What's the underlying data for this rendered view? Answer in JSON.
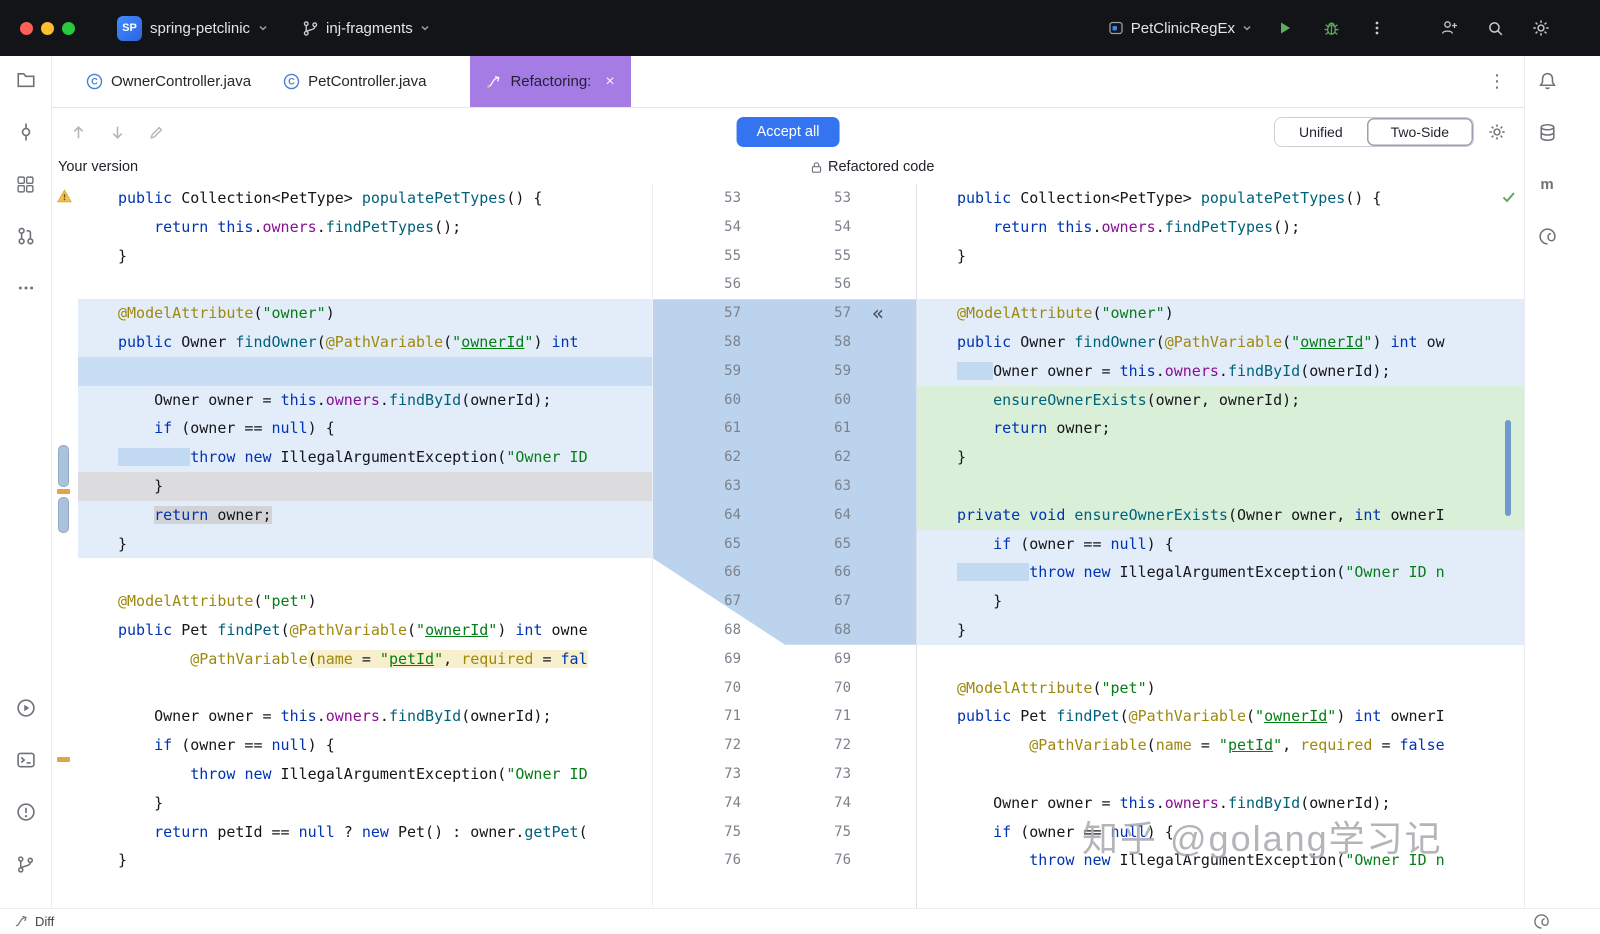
{
  "titlebar": {
    "project_badge": "SP",
    "project": "spring-petclinic",
    "branch": "inj-fragments",
    "run_config": "PetClinicRegEx"
  },
  "tabbar": {
    "tabs": [
      {
        "label": "OwnerController.java"
      },
      {
        "label": "PetController.java"
      },
      {
        "label": "Refactoring:",
        "active": true,
        "close": "×"
      }
    ]
  },
  "toolbar": {
    "accept_all": "Accept all",
    "view_modes": {
      "unified": "Unified",
      "two_side": "Two-Side",
      "selected": "Two-Side"
    }
  },
  "statusbar": {
    "label": "Diff"
  },
  "watermark": {
    "text": "知乎 @golang学习记"
  },
  "colors": {
    "accent_blue": "#3574f0",
    "tab_purple": "#a57be4",
    "changed_line_bg": "#e3edfa",
    "added_line_bg": "#d9efd7",
    "removed_line_bg": "#dcdcde",
    "injection_fragment_bg": "#f8efcd",
    "titlebar_bg": "#131417"
  },
  "diff": {
    "left_title": "Your version",
    "right_title": "Refactored code",
    "apply_glyph": "«",
    "apply_row": 57,
    "rows": [
      {
        "n": 53,
        "l": {
          "seg": [
            {
              "t": "kw",
              "s": "public"
            },
            {
              "s": " Collection<PetType> "
            },
            {
              "t": "mth",
              "s": "populatePetTypes"
            },
            {
              "s": "() {"
            }
          ]
        },
        "r": {
          "seg": [
            {
              "t": "kw",
              "s": "public"
            },
            {
              "s": " Collection<PetType> "
            },
            {
              "t": "mth",
              "s": "populatePetTypes"
            },
            {
              "s": "() {"
            }
          ]
        }
      },
      {
        "n": 54,
        "l": {
          "seg": [
            {
              "s": "    "
            },
            {
              "t": "kw",
              "s": "return "
            },
            {
              "t": "kw",
              "s": "this"
            },
            {
              "s": "."
            },
            {
              "t": "fld",
              "s": "owners"
            },
            {
              "s": "."
            },
            {
              "t": "mth",
              "s": "findPetTypes"
            },
            {
              "s": "();"
            }
          ]
        },
        "r": {
          "seg": [
            {
              "s": "    "
            },
            {
              "t": "kw",
              "s": "return "
            },
            {
              "t": "kw",
              "s": "this"
            },
            {
              "s": "."
            },
            {
              "t": "fld",
              "s": "owners"
            },
            {
              "s": "."
            },
            {
              "t": "mth",
              "s": "findPetTypes"
            },
            {
              "s": "();"
            }
          ]
        }
      },
      {
        "n": 55,
        "l": {
          "seg": [
            {
              "s": "}"
            }
          ]
        },
        "r": {
          "seg": [
            {
              "s": "}"
            }
          ]
        }
      },
      {
        "n": 56,
        "l": {},
        "r": {}
      },
      {
        "n": 57,
        "l": {
          "bg": "b",
          "seg": [
            {
              "t": "ann",
              "s": "@ModelAttribute"
            },
            {
              "s": "("
            },
            {
              "t": "str",
              "s": "\"owner\""
            },
            {
              "s": ")"
            }
          ]
        },
        "r": {
          "bg": "b",
          "seg": [
            {
              "t": "ann",
              "s": "@ModelAttribute"
            },
            {
              "s": "("
            },
            {
              "t": "str",
              "s": "\"owner\""
            },
            {
              "s": ")"
            }
          ]
        }
      },
      {
        "n": 58,
        "l": {
          "bg": "b",
          "seg": [
            {
              "t": "kw",
              "s": "public"
            },
            {
              "s": " Owner "
            },
            {
              "t": "mth",
              "s": "findOwner"
            },
            {
              "s": "("
            },
            {
              "t": "ann",
              "s": "@PathVariable"
            },
            {
              "s": "("
            },
            {
              "t": "str",
              "s": "\""
            },
            {
              "t": "stru",
              "s": "ownerId"
            },
            {
              "t": "str",
              "s": "\""
            },
            {
              "s": ") "
            },
            {
              "t": "kw",
              "s": "int"
            }
          ]
        },
        "r": {
          "bg": "b",
          "seg": [
            {
              "t": "kw",
              "s": "public"
            },
            {
              "s": " Owner "
            },
            {
              "t": "mth",
              "s": "findOwner"
            },
            {
              "s": "("
            },
            {
              "t": "ann",
              "s": "@PathVariable"
            },
            {
              "s": "("
            },
            {
              "t": "str",
              "s": "\""
            },
            {
              "t": "stru",
              "s": "ownerId"
            },
            {
              "t": "str",
              "s": "\""
            },
            {
              "s": ") "
            },
            {
              "t": "kw",
              "s": "int"
            },
            {
              "s": " ow"
            }
          ]
        }
      },
      {
        "n": 59,
        "l": {
          "bg": "b2"
        },
        "r": {
          "bg": "b",
          "seg": [
            {
              "h": "b",
              "s": "    "
            },
            {
              "s": "Owner owner = "
            },
            {
              "t": "kw",
              "s": "this"
            },
            {
              "s": "."
            },
            {
              "t": "fld",
              "s": "owners"
            },
            {
              "s": "."
            },
            {
              "t": "mth",
              "s": "findById"
            },
            {
              "s": "(ownerId);"
            }
          ]
        }
      },
      {
        "n": 60,
        "l": {
          "bg": "b",
          "seg": [
            {
              "s": "    Owner owner = "
            },
            {
              "t": "kw",
              "s": "this"
            },
            {
              "s": "."
            },
            {
              "t": "fld",
              "s": "owners"
            },
            {
              "s": "."
            },
            {
              "t": "mth",
              "s": "findById"
            },
            {
              "s": "(ownerId);"
            }
          ]
        },
        "r": {
          "bg": "g",
          "seg": [
            {
              "s": "    "
            },
            {
              "t": "mth",
              "s": "ensureOwnerExists"
            },
            {
              "s": "(owner, ownerId);"
            }
          ]
        }
      },
      {
        "n": 61,
        "l": {
          "bg": "b",
          "seg": [
            {
              "s": "    "
            },
            {
              "t": "kw",
              "s": "if"
            },
            {
              "s": " (owner == "
            },
            {
              "t": "kw",
              "s": "null"
            },
            {
              "s": ") {"
            }
          ]
        },
        "r": {
          "bg": "g",
          "seg": [
            {
              "s": "    "
            },
            {
              "t": "kw",
              "s": "return"
            },
            {
              "s": " owner;"
            }
          ]
        }
      },
      {
        "n": 62,
        "l": {
          "bg": "b",
          "seg": [
            {
              "h": "b",
              "s": "        "
            },
            {
              "t": "kw",
              "s": "throw "
            },
            {
              "t": "kw",
              "s": "new"
            },
            {
              "s": " IllegalArgumentException("
            },
            {
              "t": "str",
              "s": "\"Owner ID"
            }
          ]
        },
        "r": {
          "bg": "g",
          "seg": [
            {
              "s": "}"
            }
          ]
        }
      },
      {
        "n": 63,
        "l": {
          "bg": "x",
          "seg": [
            {
              "s": "    }"
            }
          ]
        },
        "r": {
          "bg": "g"
        }
      },
      {
        "n": 64,
        "l": {
          "bg": "b",
          "seg": [
            {
              "s": "    "
            },
            {
              "t": "kw",
              "h": "g",
              "s": "return "
            },
            {
              "h": "g",
              "s": "owner;"
            }
          ]
        },
        "r": {
          "bg": "g",
          "seg": [
            {
              "t": "kw",
              "s": "private void"
            },
            {
              "s": " "
            },
            {
              "t": "mth",
              "s": "ensureOwnerExists"
            },
            {
              "s": "(Owner owner, "
            },
            {
              "t": "kw",
              "s": "int"
            },
            {
              "s": " ownerI"
            }
          ]
        }
      },
      {
        "n": 65,
        "l": {
          "bg": "b",
          "seg": [
            {
              "s": "}"
            }
          ]
        },
        "r": {
          "bg": "b",
          "seg": [
            {
              "s": "    "
            },
            {
              "t": "kw",
              "s": "if"
            },
            {
              "s": " (owner == "
            },
            {
              "t": "kw",
              "s": "null"
            },
            {
              "s": ") {"
            }
          ]
        }
      },
      {
        "n": 66,
        "l": {},
        "r": {
          "bg": "b",
          "seg": [
            {
              "h": "b",
              "s": "        "
            },
            {
              "t": "kw",
              "s": "throw "
            },
            {
              "t": "kw",
              "s": "new"
            },
            {
              "s": " IllegalArgumentException("
            },
            {
              "t": "str",
              "s": "\"Owner ID n"
            }
          ]
        }
      },
      {
        "n": 67,
        "l": {
          "seg": [
            {
              "t": "ann",
              "s": "@ModelAttribute"
            },
            {
              "s": "("
            },
            {
              "t": "str",
              "s": "\"pet\""
            },
            {
              "s": ")"
            }
          ]
        },
        "r": {
          "bg": "b",
          "seg": [
            {
              "s": "    }"
            }
          ]
        }
      },
      {
        "n": 68,
        "l": {
          "seg": [
            {
              "t": "kw",
              "s": "public"
            },
            {
              "s": " Pet "
            },
            {
              "t": "mth",
              "s": "findPet"
            },
            {
              "s": "("
            },
            {
              "t": "ann",
              "s": "@PathVariable"
            },
            {
              "s": "("
            },
            {
              "t": "str",
              "s": "\""
            },
            {
              "t": "stru",
              "s": "ownerId"
            },
            {
              "t": "str",
              "s": "\""
            },
            {
              "s": ") "
            },
            {
              "t": "kw",
              "s": "int"
            },
            {
              "s": " owne"
            }
          ]
        },
        "r": {
          "bg": "b",
          "seg": [
            {
              "s": "}"
            }
          ]
        }
      },
      {
        "n": 69,
        "l": {
          "seg": [
            {
              "s": "        "
            },
            {
              "t": "ann",
              "s": "@PathVariable"
            },
            {
              "h": "y",
              "s": "("
            },
            {
              "t": "ann",
              "h": "y",
              "s": "name"
            },
            {
              "h": "y",
              "s": " = "
            },
            {
              "t": "str",
              "h": "y",
              "s": "\""
            },
            {
              "t": "stru",
              "h": "y",
              "s": "petId"
            },
            {
              "t": "str",
              "h": "y",
              "s": "\""
            },
            {
              "h": "y",
              "s": ", "
            },
            {
              "t": "ann",
              "h": "y",
              "s": "required"
            },
            {
              "h": "y",
              "s": " = "
            },
            {
              "t": "kw",
              "h": "y",
              "s": "fal"
            }
          ]
        },
        "r": {}
      },
      {
        "n": 70,
        "l": {},
        "r": {
          "seg": [
            {
              "t": "ann",
              "s": "@ModelAttribute"
            },
            {
              "s": "("
            },
            {
              "t": "str",
              "s": "\"pet\""
            },
            {
              "s": ")"
            }
          ]
        }
      },
      {
        "n": 71,
        "l": {
          "seg": [
            {
              "s": "    Owner owner = "
            },
            {
              "t": "kw",
              "s": "this"
            },
            {
              "s": "."
            },
            {
              "t": "fld",
              "s": "owners"
            },
            {
              "s": "."
            },
            {
              "t": "mth",
              "s": "findById"
            },
            {
              "s": "(ownerId);"
            }
          ]
        },
        "r": {
          "seg": [
            {
              "t": "kw",
              "s": "public"
            },
            {
              "s": " Pet "
            },
            {
              "t": "mth",
              "s": "findPet"
            },
            {
              "s": "("
            },
            {
              "t": "ann",
              "s": "@PathVariable"
            },
            {
              "s": "("
            },
            {
              "t": "str",
              "s": "\""
            },
            {
              "t": "stru",
              "s": "ownerId"
            },
            {
              "t": "str",
              "s": "\""
            },
            {
              "s": ") "
            },
            {
              "t": "kw",
              "s": "int"
            },
            {
              "s": " ownerI"
            }
          ]
        }
      },
      {
        "n": 72,
        "l": {
          "seg": [
            {
              "s": "    "
            },
            {
              "t": "kw",
              "s": "if"
            },
            {
              "s": " (owner == "
            },
            {
              "t": "kw",
              "s": "null"
            },
            {
              "s": ") {"
            }
          ]
        },
        "r": {
          "seg": [
            {
              "s": "        "
            },
            {
              "t": "ann",
              "s": "@PathVariable"
            },
            {
              "s": "("
            },
            {
              "t": "ann",
              "s": "name"
            },
            {
              "s": " = "
            },
            {
              "t": "str",
              "s": "\""
            },
            {
              "t": "stru",
              "s": "petId"
            },
            {
              "t": "str",
              "s": "\""
            },
            {
              "s": ", "
            },
            {
              "t": "ann",
              "s": "required"
            },
            {
              "s": " = "
            },
            {
              "t": "kw",
              "s": "false"
            }
          ]
        }
      },
      {
        "n": 73,
        "l": {
          "seg": [
            {
              "s": "        "
            },
            {
              "t": "kw",
              "s": "throw "
            },
            {
              "t": "kw",
              "s": "new"
            },
            {
              "s": " IllegalArgumentException("
            },
            {
              "t": "str",
              "s": "\"Owner ID"
            }
          ]
        },
        "r": {}
      },
      {
        "n": 74,
        "l": {
          "seg": [
            {
              "s": "    }"
            }
          ]
        },
        "r": {
          "seg": [
            {
              "s": "    Owner owner = "
            },
            {
              "t": "kw",
              "s": "this"
            },
            {
              "s": "."
            },
            {
              "t": "fld",
              "s": "owners"
            },
            {
              "s": "."
            },
            {
              "t": "mth",
              "s": "findById"
            },
            {
              "s": "(ownerId);"
            }
          ]
        }
      },
      {
        "n": 75,
        "l": {
          "seg": [
            {
              "s": "    "
            },
            {
              "t": "kw",
              "s": "return"
            },
            {
              "s": " petId == "
            },
            {
              "t": "kw",
              "s": "null"
            },
            {
              "s": " ? "
            },
            {
              "t": "kw",
              "s": "new"
            },
            {
              "s": " Pet() : owner."
            },
            {
              "t": "mth",
              "s": "getPet"
            },
            {
              "s": "("
            }
          ]
        },
        "r": {
          "seg": [
            {
              "s": "    "
            },
            {
              "t": "kw",
              "s": "if"
            },
            {
              "s": " (owner == "
            },
            {
              "t": "kw",
              "s": "null"
            },
            {
              "s": ") {"
            }
          ]
        }
      },
      {
        "n": 76,
        "l": {
          "seg": [
            {
              "s": "}"
            }
          ]
        },
        "r": {
          "seg": [
            {
              "s": "        "
            },
            {
              "t": "kw",
              "s": "throw "
            },
            {
              "t": "kw",
              "s": "new"
            },
            {
              "s": " IllegalArgumentException("
            },
            {
              "t": "str",
              "s": "\"Owner ID n"
            }
          ]
        }
      }
    ]
  }
}
